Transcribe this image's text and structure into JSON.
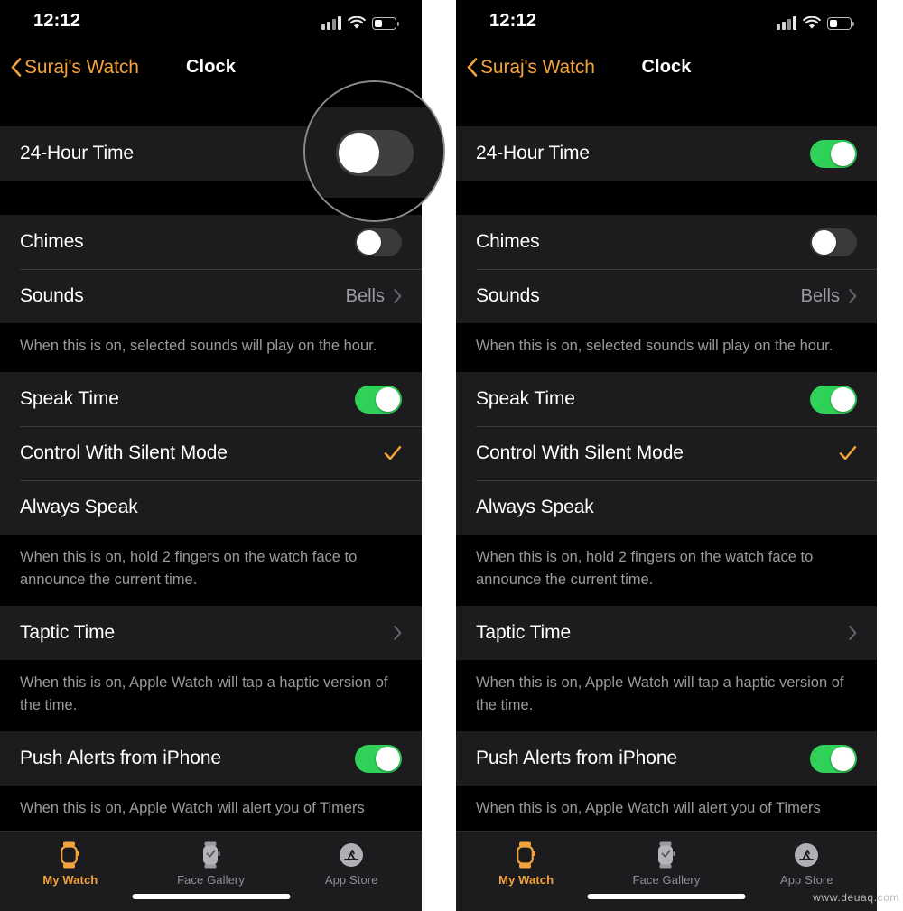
{
  "status_bar": {
    "time": "12:12",
    "signal_icon": "cellular-signal-icon",
    "wifi_icon": "wifi-icon",
    "battery_icon": "battery-icon",
    "battery_level_percent": 38
  },
  "nav": {
    "back_label": "Suraj's Watch",
    "back_icon": "chevron-left-icon",
    "title": "Clock"
  },
  "colors": {
    "accent": "#f2a33c",
    "toggle_on": "#30d158",
    "toggle_off": "#3a3a3c",
    "cell_background": "#1c1c1e",
    "page_background": "#000000",
    "separator": "#3a3a3c",
    "secondary_text": "#9a9a9e"
  },
  "rows": {
    "twenty_four_hour": {
      "label": "24-Hour Time",
      "control": "toggle",
      "state_left": "off",
      "state_right": "on"
    },
    "chimes": {
      "label": "Chimes",
      "control": "toggle",
      "state": "off"
    },
    "sounds": {
      "label": "Sounds",
      "value": "Bells",
      "control": "disclosure",
      "chevron_icon": "chevron-right-icon"
    },
    "chimes_footnote": "When this is on, selected sounds will play on the hour.",
    "speak_time": {
      "label": "Speak Time",
      "control": "toggle",
      "state": "on"
    },
    "control_with_silent_mode": {
      "label": "Control With Silent Mode",
      "control": "checkmark",
      "checkmark_icon": "checkmark-icon",
      "selected": true
    },
    "always_speak": {
      "label": "Always Speak",
      "control": "none",
      "selected": false
    },
    "speak_footnote": "When this is on, hold 2 fingers on the watch face to announce the current time.",
    "taptic_time": {
      "label": "Taptic Time",
      "control": "disclosure",
      "chevron_icon": "chevron-right-icon"
    },
    "taptic_footnote": "When this is on, Apple Watch will tap a haptic version of the time.",
    "push_alerts": {
      "label": "Push Alerts from iPhone",
      "control": "toggle",
      "state": "on"
    },
    "push_footnote": "When this is on, Apple Watch will alert you of Timers"
  },
  "tabbar": {
    "tabs": [
      {
        "label": "My Watch",
        "icon": "apple-watch-icon",
        "active": true
      },
      {
        "label": "Face Gallery",
        "icon": "watch-face-icon",
        "active": false
      },
      {
        "label": "App Store",
        "icon": "app-store-icon",
        "active": false
      }
    ]
  },
  "watermark": "www.deuaq.com"
}
